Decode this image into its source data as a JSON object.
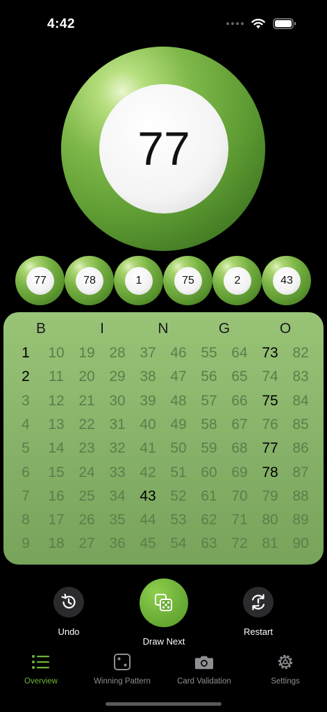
{
  "status_bar": {
    "time": "4:42"
  },
  "current_ball": {
    "number": "77"
  },
  "recent_balls": [
    "77",
    "78",
    "1",
    "75",
    "2",
    "43"
  ],
  "board": {
    "letters": [
      "B",
      "I",
      "N",
      "G",
      "O"
    ],
    "columns": [
      [
        "1",
        "2",
        "3",
        "4",
        "5",
        "6",
        "7",
        "8",
        "9"
      ],
      [
        "10",
        "11",
        "12",
        "13",
        "14",
        "15",
        "16",
        "17",
        "18"
      ],
      [
        "19",
        "20",
        "21",
        "22",
        "23",
        "24",
        "25",
        "26",
        "27"
      ],
      [
        "28",
        "29",
        "30",
        "31",
        "32",
        "33",
        "34",
        "35",
        "36"
      ],
      [
        "37",
        "38",
        "39",
        "40",
        "41",
        "42",
        "43",
        "44",
        "45"
      ],
      [
        "46",
        "47",
        "48",
        "49",
        "50",
        "51",
        "52",
        "53",
        "54"
      ],
      [
        "55",
        "56",
        "57",
        "58",
        "59",
        "60",
        "61",
        "62",
        "63"
      ],
      [
        "64",
        "65",
        "66",
        "67",
        "68",
        "69",
        "70",
        "71",
        "72"
      ],
      [
        "73",
        "74",
        "75",
        "76",
        "77",
        "78",
        "79",
        "80",
        "81"
      ],
      [
        "82",
        "83",
        "84",
        "85",
        "86",
        "87",
        "88",
        "89",
        "90"
      ]
    ],
    "called": [
      "1",
      "2",
      "43",
      "73",
      "75",
      "77",
      "78"
    ]
  },
  "controls": {
    "undo_label": "Undo",
    "draw_label": "Draw Next",
    "restart_label": "Restart"
  },
  "tabs": [
    {
      "label": "Overview",
      "icon": "list-icon",
      "active": true
    },
    {
      "label": "Winning Pattern",
      "icon": "dice-one-icon",
      "active": false
    },
    {
      "label": "Card Validation",
      "icon": "camera-icon",
      "active": false
    },
    {
      "label": "Settings",
      "icon": "gear-icon",
      "active": false
    }
  ],
  "colors": {
    "accent": "#6fb339",
    "board_bg": "#8ab56c",
    "uncalled_number": "#5d7d4a",
    "called_number": "#000000"
  }
}
